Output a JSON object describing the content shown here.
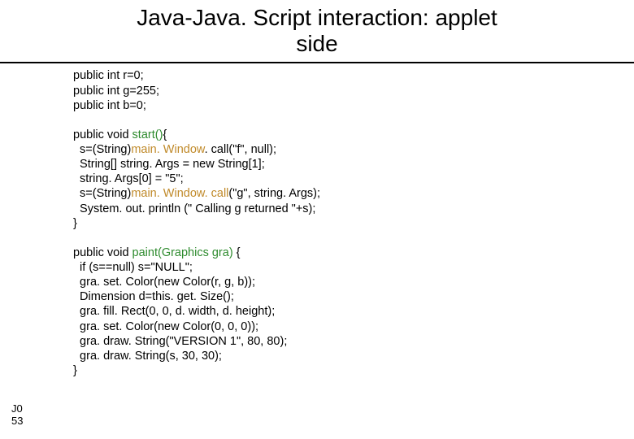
{
  "title_line1": "Java-Java. Script interaction: applet",
  "title_line2": "side",
  "code": {
    "l1": "public int r=0;",
    "l2": "public int g=255;",
    "l3": "public int b=0;",
    "l4": "public void ",
    "l4_fn": "start()",
    "l4_tail": "{",
    "l5a": "  s=(String)",
    "l5_mw": "main. Window",
    "l5b": ". call(\"f\", null);",
    "l6": "  String[] string. Args = new String[1];",
    "l7": "  string. Args[0] = \"5\";",
    "l8a": "  s=(String)",
    "l8_mw": "main. Window. call",
    "l8b": "(\"g\", string. Args);",
    "l9": "  System. out. println (\" Calling g returned \"+s);",
    "l10": "}",
    "l11": "public void ",
    "l11_fn": "paint(Graphics gra)",
    "l11_tail": " {",
    "l12": "  if (s==null) s=\"NULL\";",
    "l13": "  gra. set. Color(new Color(r, g, b));",
    "l14": "  Dimension d=this. get. Size();",
    "l15": "  gra. fill. Rect(0, 0, d. width, d. height);",
    "l16": "  gra. set. Color(new Color(0, 0, 0));",
    "l17": "  gra. draw. String(\"VERSION 1\", 80, 80);",
    "l18": "  gra. draw. String(s, 30, 30);",
    "l19": "}"
  },
  "slide_label_top": "J0",
  "slide_label_bottom": "53"
}
